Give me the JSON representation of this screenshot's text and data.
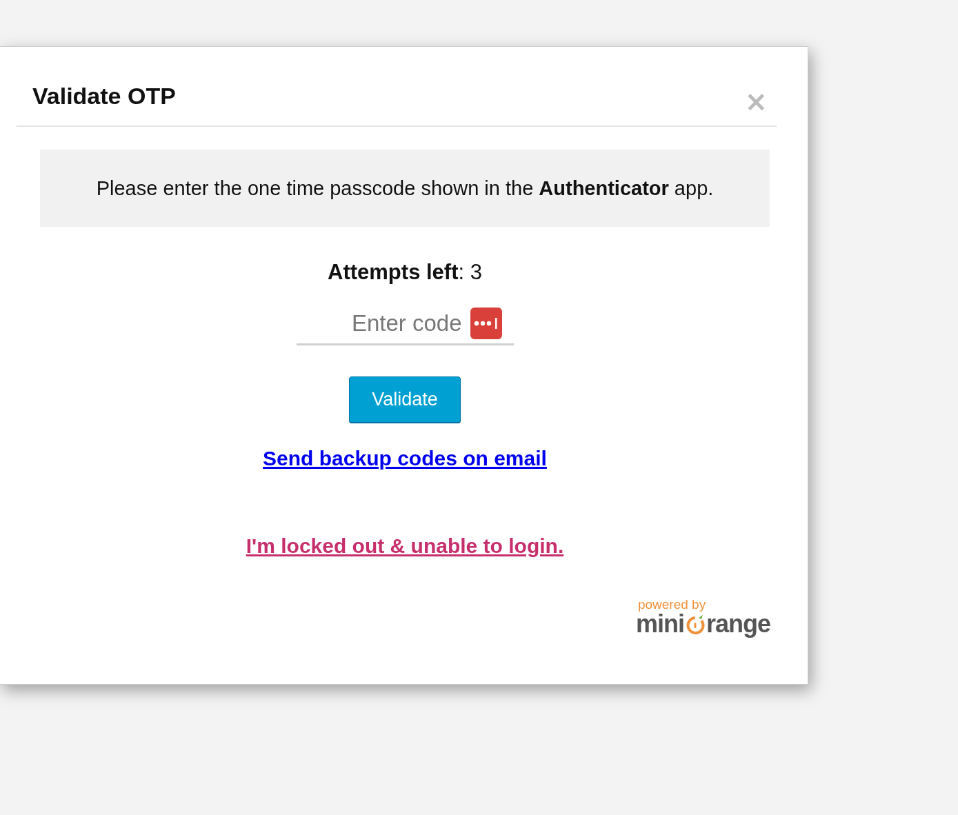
{
  "dialog": {
    "title": "Validate OTP",
    "close": "×"
  },
  "message": "Please enter the one time passcode shown in the **Authenticator** app.",
  "attempts": "**Attempts left**: 3",
  "code_field": {
    "placeholder": "Enter code"
  },
  "buttons": [
    "Validate"
  ],
  "links": [
    {
      "text": "Send backup codes on email",
      "kind": "primary"
    },
    {
      "text": "I'm locked out & unable to login.",
      "kind": "warning"
    }
  ],
  "logo": {
    "tagline": "powered by",
    "brand_left": "mini",
    "brand_right": "range"
  }
}
